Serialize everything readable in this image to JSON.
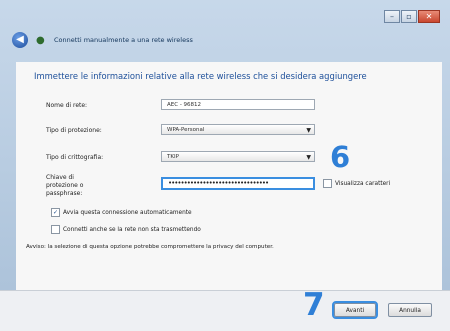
{
  "window": {
    "controls": [
      "–",
      "▫",
      "✕"
    ],
    "breadcrumb": "Connetti manualmente a una rete wireless"
  },
  "heading": "Immettere le informazioni relative alla rete wireless che si desidera aggiungere",
  "form": {
    "network_name_label": "Nome di rete:",
    "network_name_value": "AEC - 96812",
    "security_type_label": "Tipo di protezione:",
    "security_type_value": "WPA-Personal",
    "encryption_type_label": "Tipo di crittografia:",
    "encryption_type_value": "TKIP",
    "security_key_label": "Chiave di protezione o passphrase:",
    "security_key_value": "••••••••••••••••••••••••••••••••",
    "show_chars_label": "Visualizza caratteri",
    "auto_connect_label": "Avvia questa connessione automaticamente",
    "auto_connect_checked": true,
    "connect_hidden_label": "Connetti anche se la rete non sta trasmettendo",
    "connect_hidden_checked": false,
    "warning": "Avviso: la selezione di questa opzione potrebbe compromettere la privacy del computer."
  },
  "callouts": {
    "step_six": "6",
    "step_seven": "7"
  },
  "buttons": {
    "next": "Avanti",
    "cancel": "Annulla"
  },
  "colors": {
    "accent": "#2f7fd6",
    "heading": "#1d4f9a"
  }
}
